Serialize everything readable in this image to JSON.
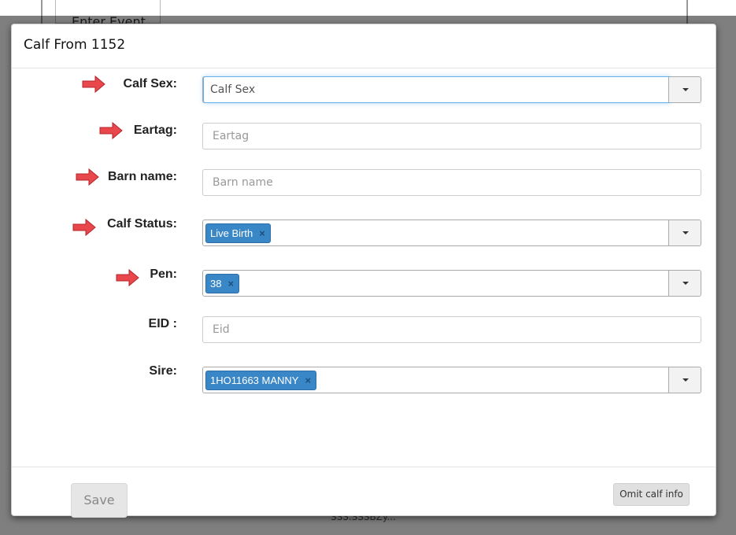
{
  "background": {
    "tab_label": "Enter Event",
    "footer_text": "SSS.SSSBZy..."
  },
  "modal": {
    "title": "Calf From 1152"
  },
  "form": {
    "calf_sex": {
      "label": "Calf Sex:",
      "placeholder": "Calf Sex"
    },
    "eartag": {
      "label": "Eartag:",
      "placeholder": "Eartag"
    },
    "barn_name": {
      "label": "Barn name:",
      "placeholder": "Barn name"
    },
    "calf_status": {
      "label": "Calf Status:",
      "selected": "Live Birth"
    },
    "pen": {
      "label": "Pen:",
      "selected": "38"
    },
    "eid": {
      "label": "EID :",
      "placeholder": "Eid"
    },
    "sire": {
      "label": "Sire:",
      "selected": "1HO11663 MANNY"
    },
    "tag_remove": "×"
  },
  "footer": {
    "save_label": "Save",
    "omit_label": "Omit calf info"
  },
  "colors": {
    "tag_bg": "#3a87c8",
    "arrow": "#e8474c",
    "focus_border": "#66afe9"
  },
  "icons": {
    "arrow": "red-arrow-icon",
    "caret": "caret-down-icon",
    "remove": "remove-tag-icon"
  }
}
